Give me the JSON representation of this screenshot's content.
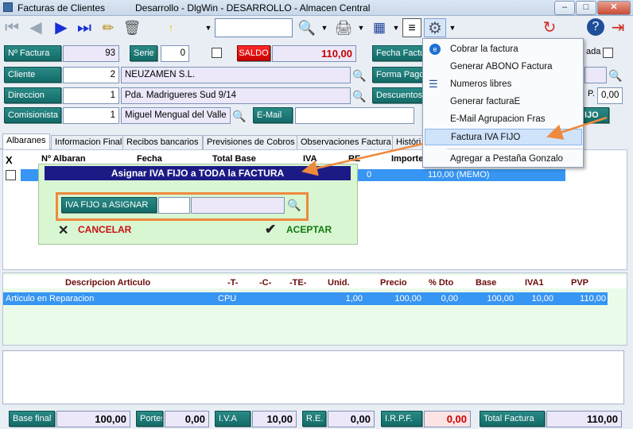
{
  "window": {
    "app_title": "Facturas de Clientes",
    "context_title": "Desarrollo - DlgWin - DESARROLLO  -  Almacen Central",
    "min_label": "–",
    "max_label": "□",
    "close_label": "✕"
  },
  "toolbar": {
    "search_value": ""
  },
  "form": {
    "nfactura_label": "Nº Factura",
    "nfactura_value": "93",
    "serie_label": "Serie",
    "serie_value": "0",
    "saldo_label": "SALDO",
    "saldo_value": "110,00",
    "fecha_label": "Fecha Factur",
    "cliente_label": "Cliente",
    "cliente_code": "2",
    "cliente_name": "NEUZAMEN S.L.",
    "formapago_label": "Forma Pago",
    "direccion_label": "Direccion",
    "direccion_code": "1",
    "direccion_value": "Pda. Madrigueres Sud 9/14",
    "descuentos_label": "Descuentos",
    "descuento_value": "0,00",
    "comisionista_label": "Comisionista",
    "comisionista_code": "1",
    "comisionista_name": "Miguel Mengual del Valle",
    "email_label": "E-Mail",
    "email_value": "",
    "right_ada": "ada",
    "right_p": "P.",
    "right_ijo": "IJO"
  },
  "tabs": [
    {
      "label": "Albaranes"
    },
    {
      "label": "Informacion Final"
    },
    {
      "label": "Recibos bancarios"
    },
    {
      "label": "Previsiones de Cobros"
    },
    {
      "label": "Observaciones Factura"
    },
    {
      "label": "Históri"
    }
  ],
  "albaranes": {
    "x_label": "X",
    "headers": [
      "Nº Albaran",
      "Fecha",
      "Total Base",
      "IVA",
      "RE",
      "Importe"
    ],
    "row": {
      "zero": "0",
      "importe": "110,00 (MEMO)"
    }
  },
  "lines": {
    "headers": [
      "Descripcion Articulo",
      "-T-",
      "-C-",
      "-TE-",
      "Unid.",
      "Precio",
      "% Dto",
      "Base",
      "IVA1",
      "PVP"
    ],
    "row": {
      "descripcion": "Articulo en Reparacion",
      "t": "CPU",
      "unid": "1,00",
      "precio": "100,00",
      "dto": "0,00",
      "base": "100,00",
      "iva": "10,00",
      "pvp": "110,00"
    }
  },
  "dialog": {
    "title": "Asignar IVA FIJO a TODA la FACTURA",
    "field_label": "IVA FIJO a ASIGNAR",
    "field_value": "",
    "cancel_label": "CANCELAR",
    "accept_label": "ACEPTAR"
  },
  "menu": {
    "items": [
      {
        "label": "Cobrar la factura"
      },
      {
        "label": "Generar ABONO Factura"
      },
      {
        "label": "Numeros libres"
      },
      {
        "label": "Generar facturaE"
      },
      {
        "label": "E-Mail Agrupacion Fras"
      },
      {
        "label": "Factura IVA FIJO"
      },
      {
        "label": "Agregar a Pestaña Gonzalo"
      }
    ]
  },
  "footer": {
    "base_label": "Base final",
    "base_value": "100,00",
    "portes_label": "Portes",
    "portes_value": "0,00",
    "iva_label": "I.V.A",
    "iva_value": "10,00",
    "re_label": "R.E.",
    "re_value": "0,00",
    "irpf_label": "I.R.P.F.",
    "irpf_value": "0,00",
    "total_label": "Total Factura",
    "total_value": "110,00"
  },
  "colors": {
    "teal_label": "#136b68",
    "saldo": "#cc0000",
    "highlight": "#3795f3",
    "dialog_title": "#1c1b86",
    "annotation": "#ee8a3e"
  }
}
